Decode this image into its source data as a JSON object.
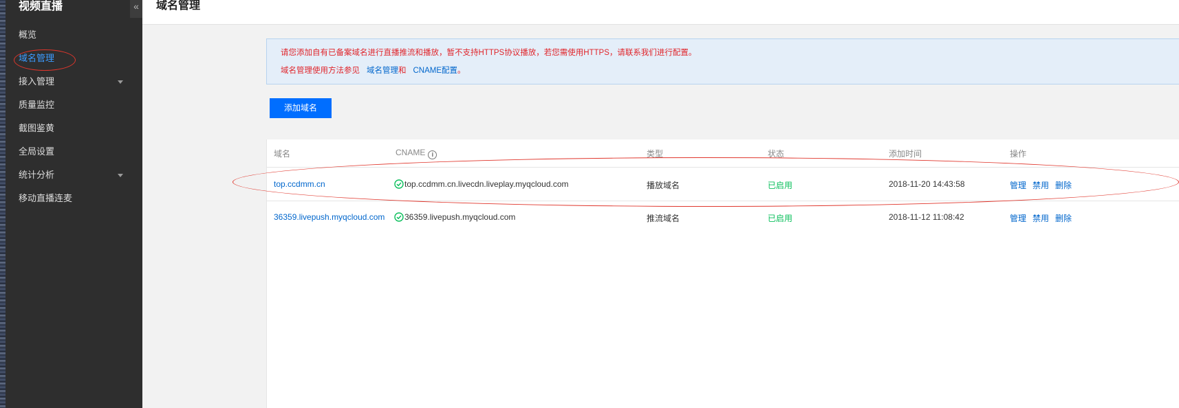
{
  "sidebar": {
    "title": "视频直播",
    "collapse_icon": "«",
    "items": [
      {
        "label": "概览",
        "active": false,
        "has_caret": false
      },
      {
        "label": "域名管理",
        "active": true,
        "has_caret": false
      },
      {
        "label": "接入管理",
        "active": false,
        "has_caret": true
      },
      {
        "label": "质量监控",
        "active": false,
        "has_caret": false
      },
      {
        "label": "截图鉴黄",
        "active": false,
        "has_caret": false
      },
      {
        "label": "全局设置",
        "active": false,
        "has_caret": false
      },
      {
        "label": "统计分析",
        "active": false,
        "has_caret": true
      },
      {
        "label": "移动直播连麦",
        "active": false,
        "has_caret": false
      }
    ]
  },
  "header": {
    "title": "域名管理"
  },
  "notice": {
    "line1": "请您添加自有已备案域名进行直播推流和播放，暂不支持HTTPS协议播放，若您需使用HTTPS，请联系我们进行配置。",
    "line2_prefix": "域名管理使用方法参见",
    "link1": "域名管理",
    "and": "和",
    "link2": "CNAME配置",
    "end": "。"
  },
  "toolbar": {
    "add_label": "添加域名"
  },
  "table": {
    "columns": [
      "域名",
      "CNAME",
      "类型",
      "状态",
      "添加时间",
      "操作"
    ],
    "info_icon": "i",
    "rows": [
      {
        "domain": "top.ccdmm.cn",
        "cname": "top.ccdmm.cn.livecdn.liveplay.myqcloud.com",
        "type": "播放域名",
        "status": "已启用",
        "added": "2018-11-20 14:43:58",
        "ops": [
          "管理",
          "禁用",
          "删除"
        ]
      },
      {
        "domain": "36359.livepush.myqcloud.com",
        "cname": "36359.livepush.myqcloud.com",
        "type": "推流域名",
        "status": "已启用",
        "added": "2018-11-12 11:08:42",
        "ops": [
          "管理",
          "禁用",
          "删除"
        ]
      }
    ]
  },
  "colors": {
    "sidebar_bg": "#2e2e2e",
    "accent": "#006eff",
    "link": "#0066cc",
    "status_ok": "#0abf5b",
    "notice_text": "#e0252b",
    "annotation": "#e0362c"
  }
}
